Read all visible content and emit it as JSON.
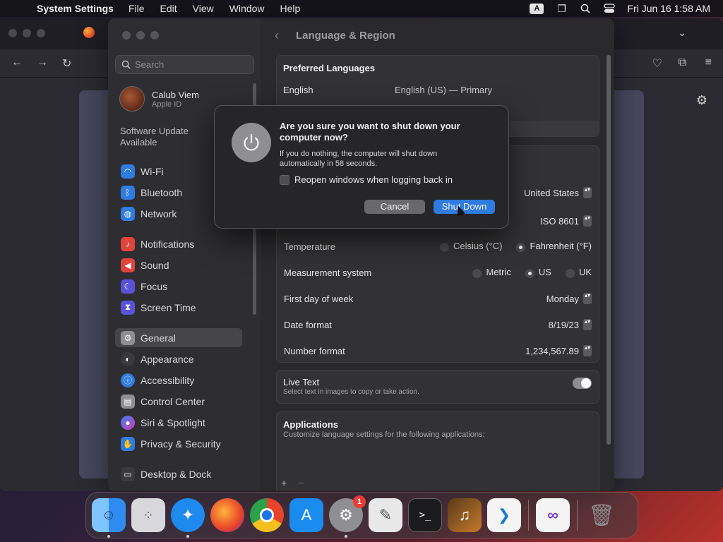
{
  "menubar": {
    "app_name": "System Settings",
    "items": [
      "File",
      "Edit",
      "View",
      "Window",
      "Help"
    ],
    "input_badge": "A",
    "clock": "Fri Jun 16  1:58 AM"
  },
  "search": {
    "placeholder": "Search"
  },
  "user": {
    "name": "Calub Viem",
    "sub": "Apple ID"
  },
  "sidebar": {
    "update_notice": "Software Update Available",
    "items": [
      {
        "label": "Wi-Fi",
        "color": "#2f7be0",
        "icon": "wifi-icon"
      },
      {
        "label": "Bluetooth",
        "color": "#2f7be0",
        "icon": "bluetooth-icon"
      },
      {
        "label": "Network",
        "color": "#2f7be0",
        "icon": "globe-icon"
      },
      {
        "label": "Notifications",
        "color": "#e0443b",
        "icon": "bell-icon"
      },
      {
        "label": "Sound",
        "color": "#e0443b",
        "icon": "speaker-icon"
      },
      {
        "label": "Focus",
        "color": "#5b52d6",
        "icon": "moon-icon"
      },
      {
        "label": "Screen Time",
        "color": "#5b52d6",
        "icon": "hourglass-icon"
      },
      {
        "label": "General",
        "color": "#8e8e93",
        "icon": "gear-icon"
      },
      {
        "label": "Appearance",
        "color": "#3a3a3c",
        "icon": "appearance-icon"
      },
      {
        "label": "Accessibility",
        "color": "#2f7be0",
        "icon": "accessibility-icon"
      },
      {
        "label": "Control Center",
        "color": "#8e8e93",
        "icon": "control-center-icon"
      },
      {
        "label": "Siri & Spotlight",
        "color": "#b23fd6",
        "icon": "siri-icon"
      },
      {
        "label": "Privacy & Security",
        "color": "#2f7be0",
        "icon": "hand-icon"
      },
      {
        "label": "Desktop & Dock",
        "color": "#3a3a3c",
        "icon": "dock-icon"
      }
    ]
  },
  "main": {
    "title": "Language & Region",
    "preferred_languages": {
      "heading": "Preferred Languages",
      "lang": "English",
      "lang_value": "English (US) — Primary"
    },
    "region": {
      "value": "United States"
    },
    "calendar": {
      "value": "ISO 8601"
    },
    "temperature": {
      "label": "Temperature",
      "opt1": "Celsius (°C)",
      "opt2": "Fahrenheit (°F)",
      "selected": "Fahrenheit (°F)"
    },
    "measurement": {
      "label": "Measurement system",
      "opt1": "Metric",
      "opt2": "US",
      "opt3": "UK",
      "selected": "US"
    },
    "first_day": {
      "label": "First day of week",
      "value": "Monday"
    },
    "date_format": {
      "label": "Date format",
      "value": "8/19/23"
    },
    "number_format": {
      "label": "Number format",
      "value": "1,234,567.89"
    },
    "live_text": {
      "label": "Live Text",
      "sub": "Select text in images to copy or take action.",
      "on": true
    },
    "applications": {
      "heading": "Applications",
      "sub": "Customize language settings for the following applications:",
      "add": "+",
      "remove": "−"
    }
  },
  "dialog": {
    "title": "Are you sure you want to shut down your computer now?",
    "message": "If you do nothing, the computer will shut down automatically in 58 seconds.",
    "checkbox_label": "Reopen windows when logging back in",
    "checkbox_checked": false,
    "cancel": "Cancel",
    "confirm": "Shut Down"
  },
  "dock": {
    "apps": [
      {
        "name": "Finder",
        "color": "#2f8bf0",
        "running": true
      },
      {
        "name": "Launchpad",
        "color": "#d8d8dc",
        "running": false
      },
      {
        "name": "Safari",
        "color": "#1e8af0",
        "running": true
      },
      {
        "name": "Firefox",
        "color": "#f0742a",
        "running": false
      },
      {
        "name": "Chrome",
        "color": "#f2f2f2",
        "running": false
      },
      {
        "name": "App Store",
        "color": "#1a8cf0",
        "running": false
      },
      {
        "name": "System Settings",
        "color": "#8e8e93",
        "running": true,
        "badge": "1"
      },
      {
        "name": "TextEdit",
        "color": "#e8e8e8",
        "running": false
      },
      {
        "name": "Terminal",
        "color": "#1c1c1e",
        "running": false
      },
      {
        "name": "GarageBand",
        "color": "#3a2a1a",
        "running": false
      },
      {
        "name": "Visual Studio Code",
        "color": "#f4f4f4",
        "running": false
      },
      {
        "name": "Visual Studio",
        "color": "#f4f4f4",
        "running": false
      },
      {
        "name": "Trash",
        "color": "#7c7c80",
        "running": false
      }
    ]
  }
}
